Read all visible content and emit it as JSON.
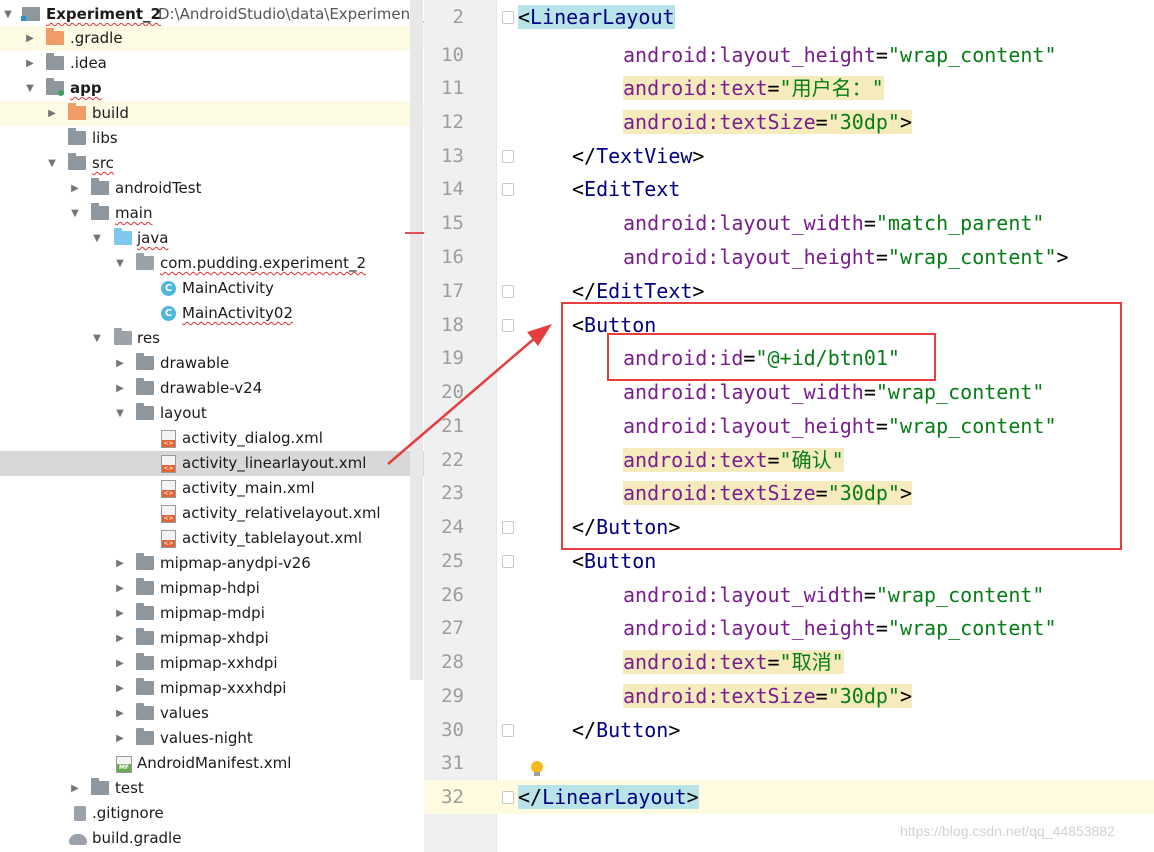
{
  "tree": {
    "project_name": "Experiment_2",
    "project_path": "D:\\AndroidStudio\\data\\Experiment_",
    "items": [
      {
        "label": ".gradle"
      },
      {
        "label": ".idea"
      },
      {
        "label": "app"
      },
      {
        "label": "build"
      },
      {
        "label": "libs"
      },
      {
        "label": "src"
      },
      {
        "label": "androidTest"
      },
      {
        "label": "main"
      },
      {
        "label": "java"
      },
      {
        "label": "com.pudding.experiment_2"
      },
      {
        "label": "MainActivity"
      },
      {
        "label": "MainActivity02"
      },
      {
        "label": "res"
      },
      {
        "label": "drawable"
      },
      {
        "label": "drawable-v24"
      },
      {
        "label": "layout"
      },
      {
        "label": "activity_dialog.xml"
      },
      {
        "label": "activity_linearlayout.xml"
      },
      {
        "label": "activity_main.xml"
      },
      {
        "label": "activity_relativelayout.xml"
      },
      {
        "label": "activity_tablelayout.xml"
      },
      {
        "label": "mipmap-anydpi-v26"
      },
      {
        "label": "mipmap-hdpi"
      },
      {
        "label": "mipmap-mdpi"
      },
      {
        "label": "mipmap-xhdpi"
      },
      {
        "label": "mipmap-xxhdpi"
      },
      {
        "label": "mipmap-xxxhdpi"
      },
      {
        "label": "values"
      },
      {
        "label": "values-night"
      },
      {
        "label": "AndroidManifest.xml"
      },
      {
        "label": "test"
      },
      {
        "label": ".gitignore"
      },
      {
        "label": "build.gradle"
      }
    ]
  },
  "editor": {
    "lines": [
      {
        "num": "2",
        "parts": [
          [
            "bkt",
            "<"
          ],
          [
            "tag",
            "LinearLayout"
          ]
        ]
      },
      {
        "num": "10",
        "parts": [
          [
            "attr",
            "android:layout_height"
          ],
          [
            "bkt",
            "="
          ],
          [
            "val",
            "\"wrap_content\""
          ]
        ]
      },
      {
        "num": "11",
        "parts": [
          [
            "attr",
            "android:text"
          ],
          [
            "bkt",
            "="
          ],
          [
            "val",
            "\"用户名：\""
          ]
        ]
      },
      {
        "num": "12",
        "parts": [
          [
            "attr",
            "android:textSize"
          ],
          [
            "bkt",
            "="
          ],
          [
            "val",
            "\"30dp\""
          ],
          [
            "bkt",
            ">"
          ]
        ]
      },
      {
        "num": "13",
        "parts": [
          [
            "bkt",
            "</"
          ],
          [
            "tag",
            "TextView"
          ],
          [
            "bkt",
            ">"
          ]
        ]
      },
      {
        "num": "14",
        "parts": [
          [
            "bkt",
            "<"
          ],
          [
            "tag",
            "EditText"
          ]
        ]
      },
      {
        "num": "15",
        "parts": [
          [
            "attr",
            "android:layout_width"
          ],
          [
            "bkt",
            "="
          ],
          [
            "val",
            "\"match_parent\""
          ]
        ]
      },
      {
        "num": "16",
        "parts": [
          [
            "attr",
            "android:layout_height"
          ],
          [
            "bkt",
            "="
          ],
          [
            "val",
            "\"wrap_content\""
          ],
          [
            "bkt",
            ">"
          ]
        ]
      },
      {
        "num": "17",
        "parts": [
          [
            "bkt",
            "</"
          ],
          [
            "tag",
            "EditText"
          ],
          [
            "bkt",
            ">"
          ]
        ]
      },
      {
        "num": "18",
        "parts": [
          [
            "bkt",
            "<"
          ],
          [
            "tag",
            "Button"
          ]
        ]
      },
      {
        "num": "19",
        "parts": [
          [
            "attr",
            "android:id"
          ],
          [
            "bkt",
            "="
          ],
          [
            "val",
            "\"@+id/btn01\""
          ]
        ]
      },
      {
        "num": "20",
        "parts": [
          [
            "attr",
            "android:layout_width"
          ],
          [
            "bkt",
            "="
          ],
          [
            "val",
            "\"wrap_content\""
          ]
        ]
      },
      {
        "num": "21",
        "parts": [
          [
            "attr",
            "android:layout_height"
          ],
          [
            "bkt",
            "="
          ],
          [
            "val",
            "\"wrap_content\""
          ]
        ]
      },
      {
        "num": "22",
        "parts": [
          [
            "attr",
            "android:text"
          ],
          [
            "bkt",
            "="
          ],
          [
            "val",
            "\"确认\""
          ]
        ]
      },
      {
        "num": "23",
        "parts": [
          [
            "attr",
            "android:textSize"
          ],
          [
            "bkt",
            "="
          ],
          [
            "val",
            "\"30dp\""
          ],
          [
            "bkt",
            ">"
          ]
        ]
      },
      {
        "num": "24",
        "parts": [
          [
            "bkt",
            "</"
          ],
          [
            "tag",
            "Button"
          ],
          [
            "bkt",
            ">"
          ]
        ]
      },
      {
        "num": "25",
        "parts": [
          [
            "bkt",
            "<"
          ],
          [
            "tag",
            "Button"
          ]
        ]
      },
      {
        "num": "26",
        "parts": [
          [
            "attr",
            "android:layout_width"
          ],
          [
            "bkt",
            "="
          ],
          [
            "val",
            "\"wrap_content\""
          ]
        ]
      },
      {
        "num": "27",
        "parts": [
          [
            "attr",
            "android:layout_height"
          ],
          [
            "bkt",
            "="
          ],
          [
            "val",
            "\"wrap_content\""
          ]
        ]
      },
      {
        "num": "28",
        "parts": [
          [
            "attr",
            "android:text"
          ],
          [
            "bkt",
            "="
          ],
          [
            "val",
            "\"取消\""
          ]
        ]
      },
      {
        "num": "29",
        "parts": [
          [
            "attr",
            "android:textSize"
          ],
          [
            "bkt",
            "="
          ],
          [
            "val",
            "\"30dp\""
          ],
          [
            "bkt",
            ">"
          ]
        ]
      },
      {
        "num": "30",
        "parts": [
          [
            "bkt",
            "</"
          ],
          [
            "tag",
            "Button"
          ],
          [
            "bkt",
            ">"
          ]
        ]
      },
      {
        "num": "31",
        "parts": []
      },
      {
        "num": "32",
        "parts": [
          [
            "bkt",
            "</"
          ],
          [
            "tag",
            "LinearLayout"
          ],
          [
            "bkt",
            ">"
          ]
        ]
      }
    ]
  },
  "watermark": "https://blog.csdn.net/qq_44853882",
  "colors": {
    "annotation": "#e53e3e",
    "tag": "#00007f",
    "attribute": "#7a1d8f",
    "value": "#067d17"
  }
}
